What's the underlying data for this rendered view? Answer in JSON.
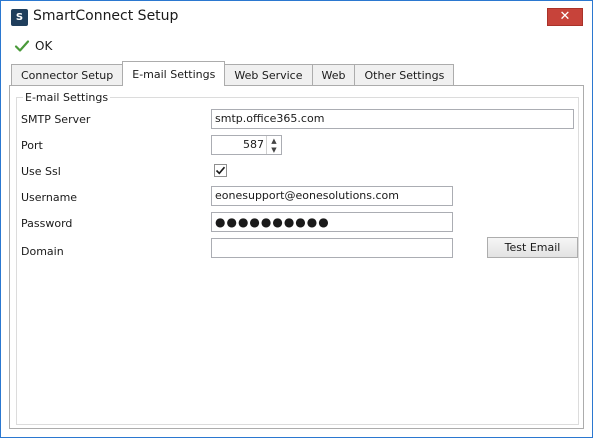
{
  "window": {
    "title": "SmartConnect Setup",
    "app_icon_glyph": "S",
    "close_glyph": "✕",
    "accent_color": "#2b78d0",
    "close_color": "#c7433a"
  },
  "toolbar": {
    "ok_label": "OK",
    "ok_icon": "checkmark-icon"
  },
  "tabs": [
    {
      "label": "Connector Setup",
      "active": false
    },
    {
      "label": "E-mail Settings",
      "active": true
    },
    {
      "label": "Web Service",
      "active": false
    },
    {
      "label": "Web",
      "active": false
    },
    {
      "label": "Other Settings",
      "active": false
    }
  ],
  "email_settings": {
    "group_title": "E-mail Settings",
    "smtp_server_label": "SMTP Server",
    "smtp_server_value": "smtp.office365.com",
    "port_label": "Port",
    "port_value": "587",
    "use_ssl_label": "Use Ssl",
    "use_ssl_checked": true,
    "username_label": "Username",
    "username_value": "eonesupport@eonesolutions.com",
    "password_label": "Password",
    "password_value": "●●●●●●●●●●",
    "domain_label": "Domain",
    "domain_value": "",
    "test_email_label": "Test Email"
  }
}
